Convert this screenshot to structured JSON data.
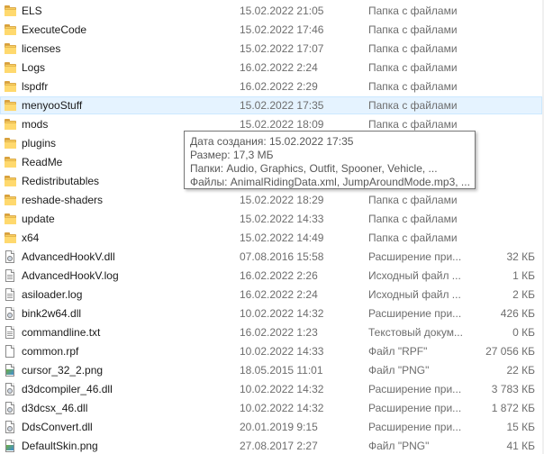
{
  "files": [
    {
      "name": "ELS",
      "date": "15.02.2022 21:05",
      "type": "Папка с файлами",
      "size": "",
      "icon": "folder-icon"
    },
    {
      "name": "ExecuteCode",
      "date": "15.02.2022 17:46",
      "type": "Папка с файлами",
      "size": "",
      "icon": "folder-icon"
    },
    {
      "name": "licenses",
      "date": "15.02.2022 17:07",
      "type": "Папка с файлами",
      "size": "",
      "icon": "folder-icon"
    },
    {
      "name": "Logs",
      "date": "16.02.2022 2:24",
      "type": "Папка с файлами",
      "size": "",
      "icon": "folder-icon"
    },
    {
      "name": "lspdfr",
      "date": "16.02.2022 2:29",
      "type": "Папка с файлами",
      "size": "",
      "icon": "folder-icon"
    },
    {
      "name": "menyooStuff",
      "date": "15.02.2022 17:35",
      "type": "Папка с файлами",
      "size": "",
      "icon": "folder-icon",
      "selected": true
    },
    {
      "name": "mods",
      "date": "15.02.2022 18:09",
      "type": "Папка с файлами",
      "size": "",
      "icon": "folder-icon"
    },
    {
      "name": "plugins",
      "date": "",
      "type": "",
      "size": "",
      "icon": "folder-icon"
    },
    {
      "name": "ReadMe",
      "date": "",
      "type": "",
      "size": "",
      "icon": "folder-icon"
    },
    {
      "name": "Redistributables",
      "date": "",
      "type": "",
      "size": "",
      "icon": "folder-icon"
    },
    {
      "name": "reshade-shaders",
      "date": "15.02.2022 18:29",
      "type": "Папка с файлами",
      "size": "",
      "icon": "folder-icon"
    },
    {
      "name": "update",
      "date": "15.02.2022 14:33",
      "type": "Папка с файлами",
      "size": "",
      "icon": "folder-icon"
    },
    {
      "name": "x64",
      "date": "15.02.2022 14:49",
      "type": "Папка с файлами",
      "size": "",
      "icon": "folder-icon"
    },
    {
      "name": "AdvancedHookV.dll",
      "date": "07.08.2016 15:58",
      "type": "Расширение при...",
      "size": "32 КБ",
      "icon": "dll-file-icon"
    },
    {
      "name": "AdvancedHookV.log",
      "date": "16.02.2022 2:26",
      "type": "Исходный файл ...",
      "size": "1 КБ",
      "icon": "text-file-icon"
    },
    {
      "name": "asiloader.log",
      "date": "16.02.2022 2:24",
      "type": "Исходный файл ...",
      "size": "2 КБ",
      "icon": "text-file-icon"
    },
    {
      "name": "bink2w64.dll",
      "date": "10.02.2022 14:32",
      "type": "Расширение при...",
      "size": "426 КБ",
      "icon": "dll-file-icon"
    },
    {
      "name": "commandline.txt",
      "date": "16.02.2022 1:23",
      "type": "Текстовый докум...",
      "size": "0 КБ",
      "icon": "text-file-icon"
    },
    {
      "name": "common.rpf",
      "date": "10.02.2022 14:33",
      "type": "Файл \"RPF\"",
      "size": "27 056 КБ",
      "icon": "blank-file-icon"
    },
    {
      "name": "cursor_32_2.png",
      "date": "18.05.2015 11:01",
      "type": "Файл \"PNG\"",
      "size": "22 КБ",
      "icon": "image-file-icon"
    },
    {
      "name": "d3dcompiler_46.dll",
      "date": "10.02.2022 14:32",
      "type": "Расширение при...",
      "size": "3 783 КБ",
      "icon": "dll-file-icon"
    },
    {
      "name": "d3dcsx_46.dll",
      "date": "10.02.2022 14:32",
      "type": "Расширение при...",
      "size": "1 872 КБ",
      "icon": "dll-file-icon"
    },
    {
      "name": "DdsConvert.dll",
      "date": "20.01.2019 9:15",
      "type": "Расширение при...",
      "size": "15 КБ",
      "icon": "dll-file-icon"
    },
    {
      "name": "DefaultSkin.png",
      "date": "27.08.2017 2:27",
      "type": "Файл \"PNG\"",
      "size": "41 КБ",
      "icon": "image-file-icon"
    }
  ],
  "tooltip": {
    "created": "Дата создания: 15.02.2022 17:35",
    "size": "Размер: 17,3 МБ",
    "folders": "Папки: Audio, Graphics, Outfit, Spooner, Vehicle, ...",
    "files": "Файлы: AnimalRidingData.xml, JumpAroundMode.mp3, ..."
  },
  "colors": {
    "selection_bg": "#e5f3ff",
    "selection_border": "#cce8ff",
    "folder": "#f8cf61",
    "muted_text": "#6d6d6d"
  }
}
